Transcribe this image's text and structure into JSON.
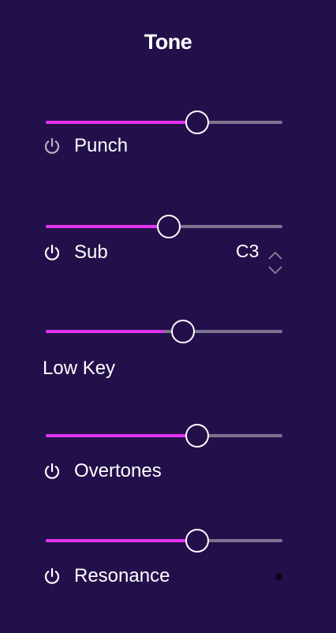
{
  "panel": {
    "title": "Tone"
  },
  "colors": {
    "background": "#23104a",
    "accent": "#e433f0",
    "track": "#7c7390",
    "thumb_border": "#ffffff",
    "power_dim": "#b7b1c3"
  },
  "controls": {
    "punch": {
      "label": "Punch",
      "value_fraction": 0.64,
      "power_icon": "power-icon",
      "power_on": false
    },
    "sub": {
      "label": "Sub",
      "value_fraction": 0.52,
      "power_icon": "power-icon",
      "power_on": true,
      "key_value": "C3",
      "stepper_icons": [
        "chevron-up-icon",
        "chevron-down-icon"
      ]
    },
    "low_key": {
      "label": "Low Key",
      "value_fraction": 0.58,
      "fill_fraction": 0.5
    },
    "overtones": {
      "label": "Overtones",
      "value_fraction": 0.64,
      "power_icon": "power-icon",
      "power_on": true
    },
    "resonance": {
      "label": "Resonance",
      "value_fraction": 0.64,
      "power_icon": "power-icon",
      "power_on": true,
      "indicator_icon": "dot-indicator-icon"
    }
  }
}
